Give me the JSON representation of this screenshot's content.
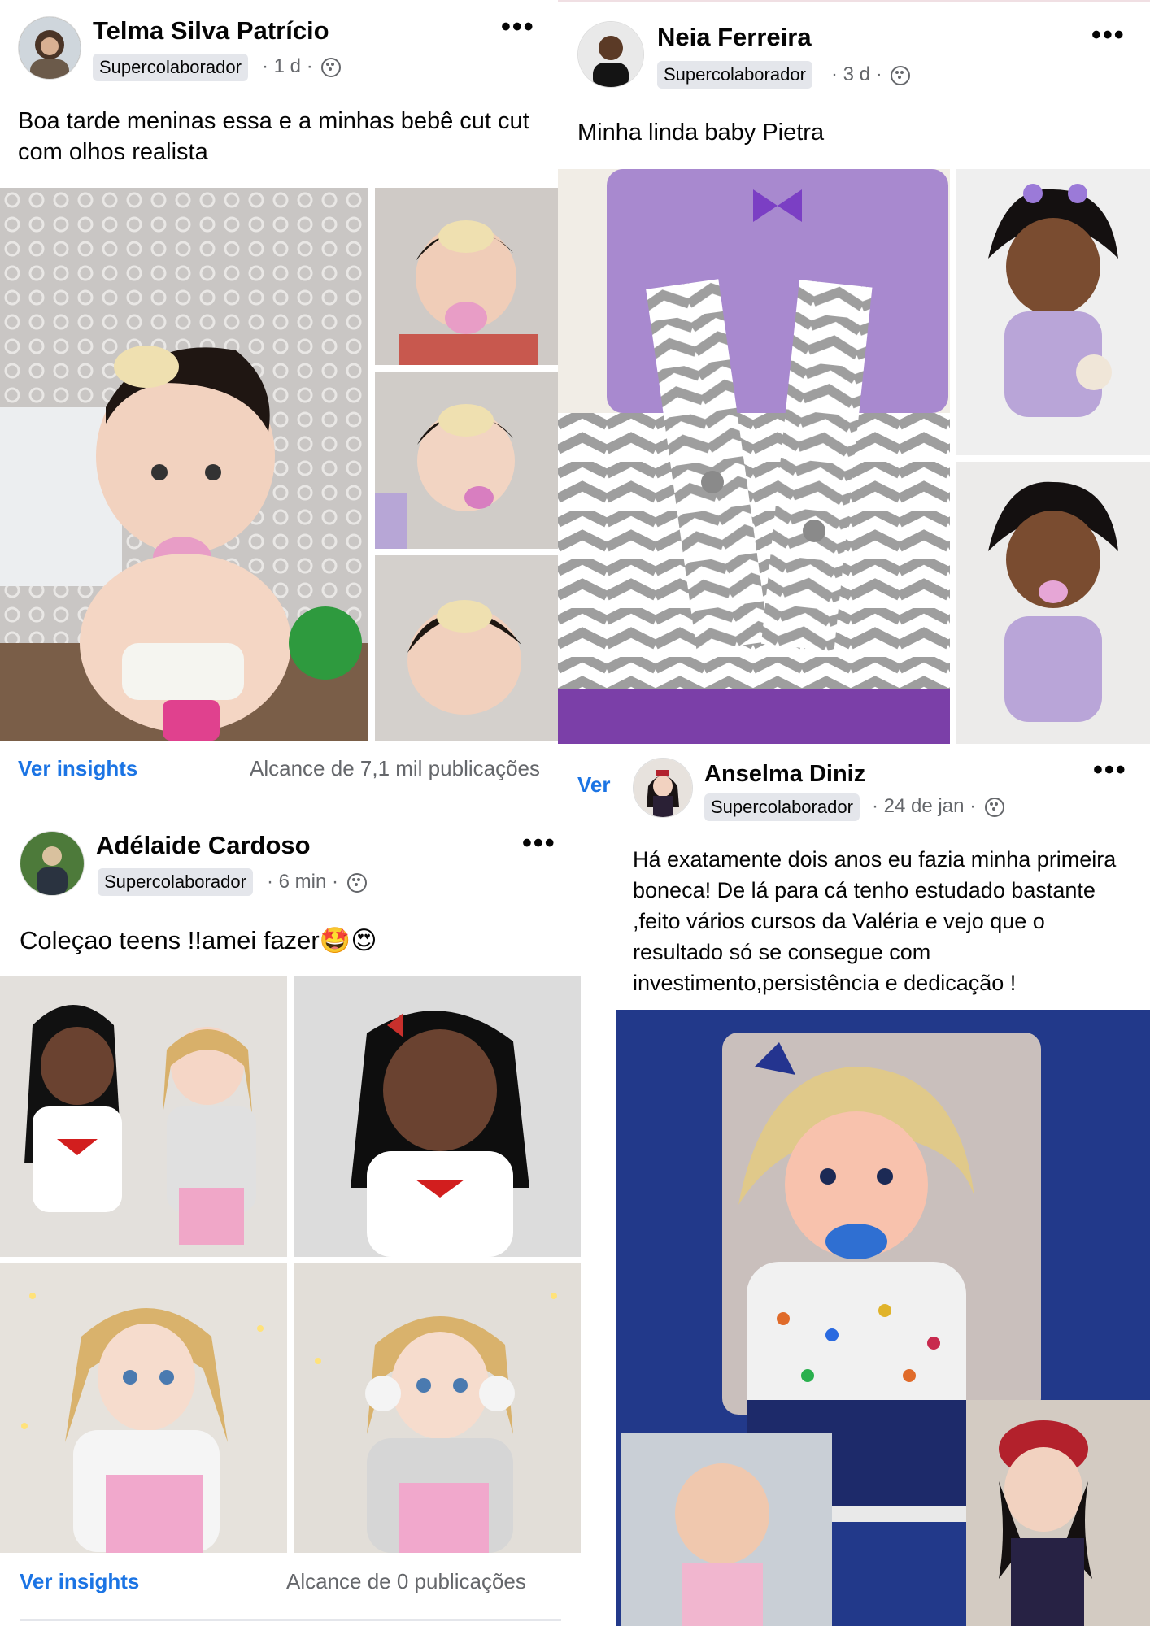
{
  "posts": {
    "telma": {
      "author": "Telma Silva Patrício",
      "badge": "Supercolaborador",
      "meta": "· 1 d ·",
      "text": "Boa tarde meninas essa e a minhas bebê cut cut com olhos realista",
      "insights_label": "Ver insights",
      "reach": "Alcance de 7,1 mil publicações"
    },
    "neia": {
      "author": "Neia Ferreira",
      "badge": "Supercolaborador",
      "meta": "· 3 d ·",
      "text": "Minha linda baby Pietra",
      "insights_label": "Ver"
    },
    "adelaide": {
      "author": "Adélaide Cardoso",
      "badge": "Supercolaborador",
      "meta": "· 6 min ·",
      "text": "Coleçao teens !!amei fazer🤩😍",
      "insights_label": "Ver insights",
      "reach": "Alcance de 0 publicações"
    },
    "anselma": {
      "author": "Anselma Diniz",
      "badge": "Supercolaborador",
      "meta": "· 24 de jan ·",
      "text": "Há exatamente dois anos eu fazia minha primeira boneca! De lá para cá tenho estudado bastante ,feito vários cursos da Valéria e vejo que o resultado só se consegue com investimento,persistência e dedicação !"
    }
  },
  "icons": {
    "more": "•••",
    "privacy": "group-icon"
  }
}
